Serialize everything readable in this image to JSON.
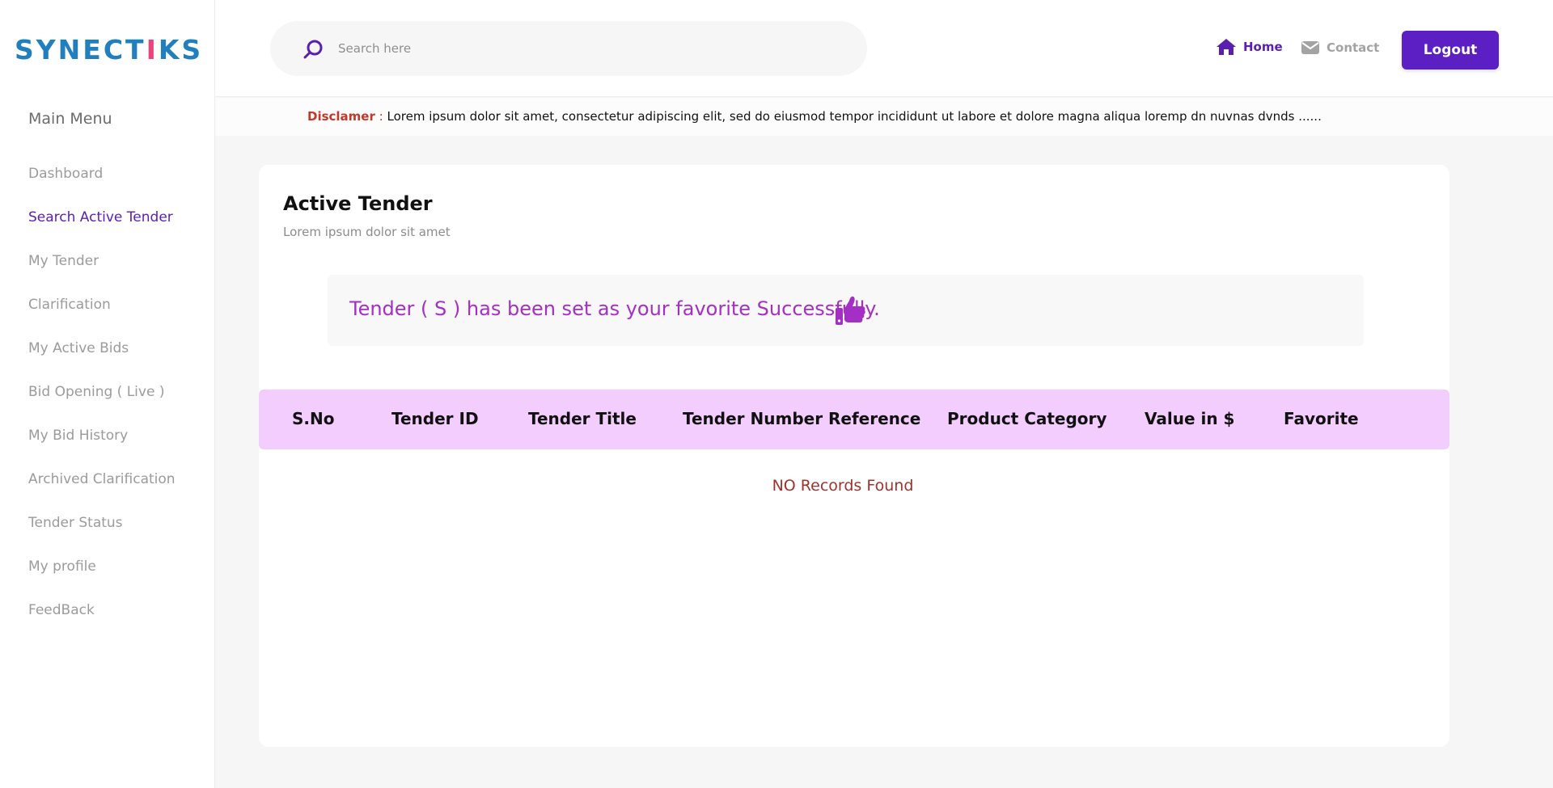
{
  "brand": {
    "logo_text_a": "SYNECT",
    "logo_text_i": "I",
    "logo_text_b": "KS"
  },
  "sidebar": {
    "title": "Main Menu",
    "items": [
      {
        "label": "Dashboard"
      },
      {
        "label": "Search Active Tender",
        "active": true
      },
      {
        "label": "My Tender"
      },
      {
        "label": "Clarification"
      },
      {
        "label": "My Active Bids"
      },
      {
        "label": "Bid Opening ( Live )"
      },
      {
        "label": "My Bid History"
      },
      {
        "label": "Archived Clarification"
      },
      {
        "label": "Tender Status"
      },
      {
        "label": "My profile"
      },
      {
        "label": "FeedBack"
      }
    ]
  },
  "header": {
    "search": {
      "placeholder": "Search here",
      "value": "",
      "icon": "search-icon"
    },
    "nav": {
      "home": "Home",
      "contact": "Contact"
    },
    "logout": "Logout"
  },
  "disclaimer": {
    "label": "Disclamer",
    "separator": ":",
    "text": "Lorem ipsum dolor sit amet, consectetur adipiscing elit, sed do eiusmod tempor incididunt ut labore et dolore magna aliqua loremp dn  nuvnas dvnds ......"
  },
  "content": {
    "title": "Active Tender",
    "subtitle": "Lorem ipsum dolor sit amet",
    "alert": {
      "text": "Tender ( S ) has been set as your favorite Successfully.",
      "icon": "thumbs-up-icon"
    },
    "table": {
      "columns": [
        "S.No",
        "Tender ID",
        "Tender Title",
        "Tender Number Reference",
        "Product Category",
        "Value in $",
        "Favorite"
      ],
      "empty_message": "NO Records Found"
    }
  },
  "colors": {
    "primary": "#5b1fc4",
    "active_menu": "#5b1fb0",
    "alert_text": "#a52fc4",
    "table_header_bg": "#f2cdfd",
    "disclaimer_label": "#c0392b",
    "empty_message": "#a0322d"
  }
}
